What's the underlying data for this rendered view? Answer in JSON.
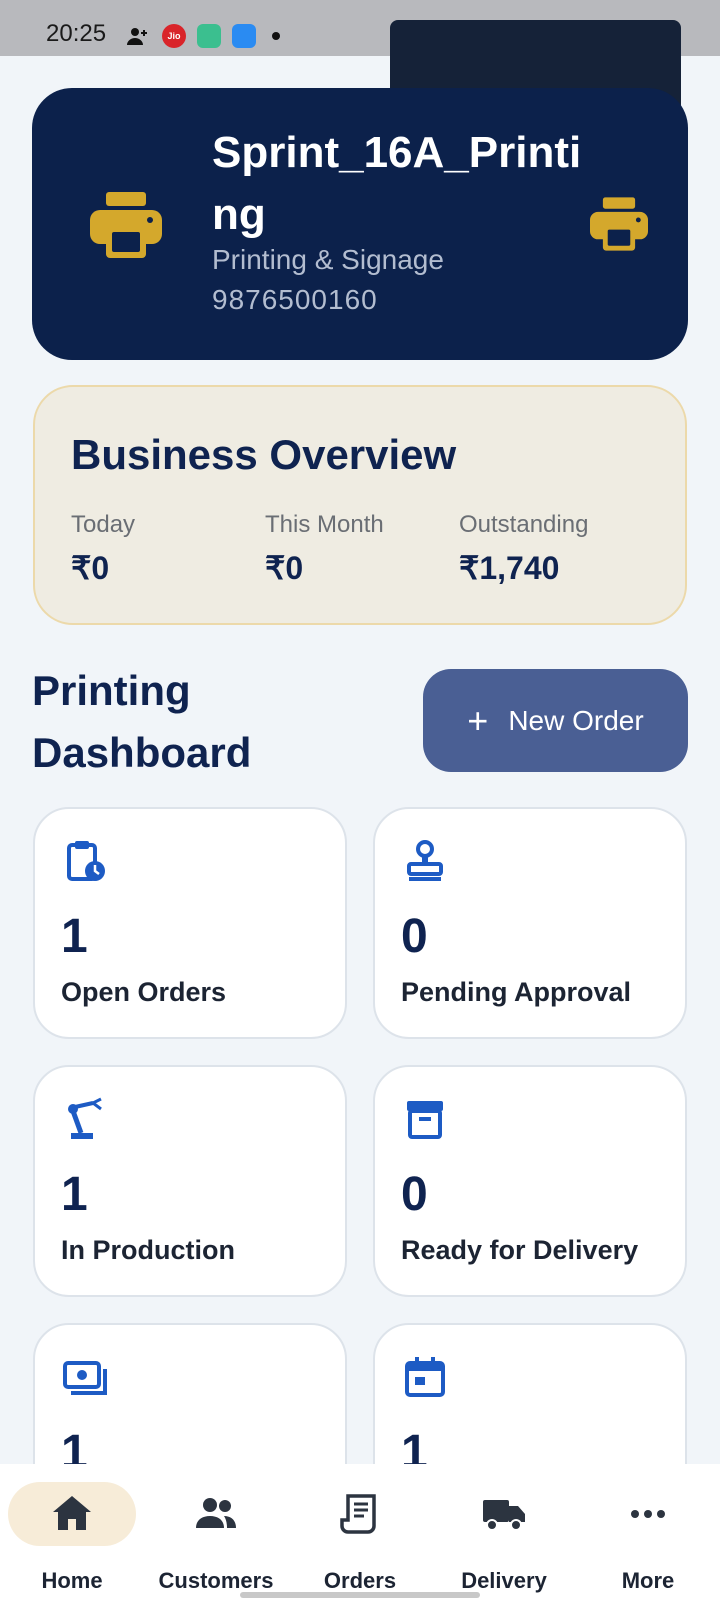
{
  "status_bar": {
    "time": "20:25",
    "jio_label": "Jio"
  },
  "business": {
    "name": "Sprint_16A_Printing",
    "category": "Printing & Signage",
    "phone": "9876500160"
  },
  "overview": {
    "title": "Business Overview",
    "stats": [
      {
        "label": "Today",
        "value": "₹0"
      },
      {
        "label": "This Month",
        "value": "₹0"
      },
      {
        "label": "Outstanding",
        "value": "₹1,740"
      }
    ]
  },
  "dashboard": {
    "title": "Printing Dashboard",
    "new_order_label": "New Order",
    "tiles": [
      {
        "icon": "clipboard-clock-icon",
        "value": "1",
        "label": "Open Orders"
      },
      {
        "icon": "stamp-icon",
        "value": "0",
        "label": "Pending Approval"
      },
      {
        "icon": "robot-arm-icon",
        "value": "1",
        "label": "In Production"
      },
      {
        "icon": "archive-box-icon",
        "value": "0",
        "label": "Ready for Delivery"
      },
      {
        "icon": "cash-icon",
        "value": "1",
        "label": ""
      },
      {
        "icon": "calendar-icon",
        "value": "1",
        "label": ""
      }
    ]
  },
  "nav": {
    "active": "Home",
    "items": [
      {
        "label": "Home",
        "icon": "home-icon"
      },
      {
        "label": "Customers",
        "icon": "people-icon"
      },
      {
        "label": "Orders",
        "icon": "receipt-icon"
      },
      {
        "label": "Delivery",
        "icon": "truck-icon"
      },
      {
        "label": "More",
        "icon": "more-dots-icon"
      }
    ]
  },
  "colors": {
    "header_bg": "#0c214b",
    "accent_gold": "#d4a82c",
    "primary_button": "#4a5f94",
    "icon_blue": "#1d5bc4",
    "nav_active_pill": "#f7ecd8"
  }
}
